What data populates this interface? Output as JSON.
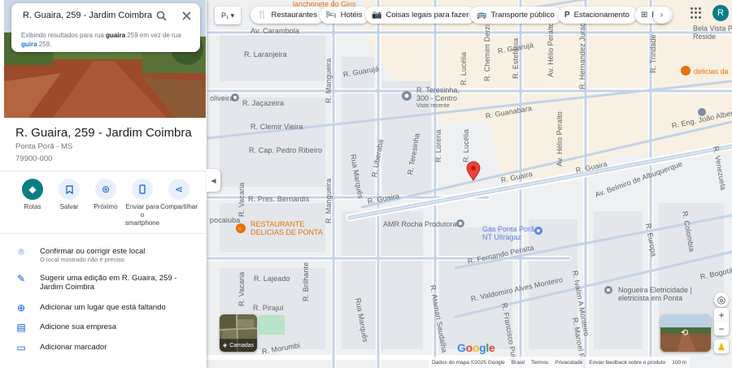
{
  "search": {
    "query": "R. Guaira, 259 - Jardim Coimbra",
    "hint_prefix": "Exibindo resultados para rua ",
    "hint_bold": "guaira",
    "hint_mid": " 259 em vez de rua ",
    "hint_link": "guira",
    "hint_suffix": " 259."
  },
  "place": {
    "title": "R. Guaira, 259 - Jardim Coimbra",
    "city": "Ponta Porã - MS",
    "postal": "79900-000"
  },
  "actions": [
    {
      "label": "Rotas",
      "icon": "directions-icon"
    },
    {
      "label": "Salvar",
      "icon": "bookmark-icon"
    },
    {
      "label": "Próximo",
      "icon": "nearby-icon"
    },
    {
      "label": "Enviar para o smartphone",
      "icon": "phone-icon"
    },
    {
      "label": "Compartilhar",
      "icon": "share-icon"
    }
  ],
  "rows": [
    {
      "label": "Confirmar ou corrigir este local",
      "sub": "O local mostrado não é preciso",
      "icon": "pin-outline-icon"
    },
    {
      "label": "Sugerir uma edição em R. Guaira, 259 - Jardim Coimbra",
      "icon": "pencil-icon"
    },
    {
      "label": "Adicionar um lugar que está faltando",
      "icon": "add-place-icon"
    },
    {
      "label": "Adicione sua empresa",
      "icon": "store-icon"
    },
    {
      "label": "Adicionar marcador",
      "icon": "label-icon"
    }
  ],
  "chips": [
    {
      "label": "Restaurantes",
      "icon": "restaurant-icon"
    },
    {
      "label": "Hotéis",
      "icon": "hotel-icon"
    },
    {
      "label": "Coisas legais para fazer",
      "icon": "camera-icon"
    },
    {
      "label": "Transporte público",
      "icon": "bus-icon"
    },
    {
      "label": "Estacionamento",
      "icon": "parking-icon"
    },
    {
      "label": "F",
      "icon": "pharmacy-icon"
    }
  ],
  "avatar_letter": "R",
  "layers_label": "Camadas",
  "map_labels": {
    "streets": {
      "carambola": "Av. Carambola",
      "laranjeira": "R. Laranjeira",
      "jacazeira": "R. Jaçazeira",
      "clemir": "R. Clemir Vieira",
      "cap": "R. Cap. Pedro Ribeiro",
      "pres": "R. Pres. Bernardis",
      "mangueira_top": "R. Mangueira",
      "mangueira_mid": "R. Mangueira",
      "guaruja": "R. Guarujá",
      "guaruja2": "R. Guarujá",
      "guanabara": "R. Guanabara",
      "guanabara2": "R. Guanabara",
      "guaira1": "R. Guaira",
      "guaira2": "R. Guaira",
      "guaira3": "R. Guaira",
      "belmiro": "Av. Belmiro de Albuquerque",
      "lorena": "R. Lorena",
      "lucelia": "R. Lucélia",
      "lucelia2": "R. Lucélia",
      "uberaba": "R. Uberaba",
      "teresinha": "R. Teresinha",
      "marques": "Rua Marquês",
      "marques2": "Rua Marquês",
      "vacaria": "R. Vacaria",
      "vacaria2": "R. Vacaria",
      "lajeado": "R. Lajeado",
      "pirajui": "R. Pirajuí",
      "brilhante": "R. Brilhante",
      "morumbi": "R. Morumbi",
      "peralta": "R. Fernando Peralta",
      "valdomiro": "R. Valdomiro Alves Monteiro",
      "chemim": "R. Chemim Derzi",
      "chemim2": "R. Chemim Derzi",
      "estefania": "R. Estefânia",
      "helio": "Av. Hélio Peralto",
      "helio2": "Av. Hélio Peralto",
      "hernandez": "R. Hernandez Jurado",
      "trindade": "R. Trindade",
      "ivalim": "R. Ivalim A Monteiro",
      "europa": "R. Europa",
      "colombia": "R. Colombia",
      "atamari": "R. Atamari Saudalha",
      "francisco": "R. Francisco Puig",
      "manoel": "R. Manoel Ramos",
      "venezuela": "R. Venezuela",
      "bogota": "R. Bogotá",
      "eng": "R. Eng. João Alberto Ca",
      "oliveira": "oliveira",
      "pocaiuba": "pocaiuba"
    },
    "pois": {
      "lanchonete": "lanchonete do Gins",
      "teresinha_name": "R. Teresinha,",
      "teresinha_addr": "300 - Centro",
      "teresinha_sub": "Visto recente",
      "restaurante1": "RESTAURANTE",
      "restaurante2": "DELICIAS DE PONTA",
      "amr": "AMR Rocha Produtora",
      "gas1": "Gás Ponta Porã",
      "gas2": "NT Ultragaz",
      "nogueira1": "Nogueira Eletricidade |",
      "nogueira2": "eletricista em Ponta",
      "bela1": "Bela Vista P",
      "bela2": "Reside",
      "delicias": "delicias da"
    }
  },
  "footer": {
    "data": "Dados do mapa ©2025 Google",
    "country": "Brasil",
    "terms": "Termos",
    "privacy": "Privacidade",
    "feedback": "Enviar feedback sobre o produto",
    "scale": "100 m"
  },
  "google_logo": "Google",
  "colors": {
    "accent": "#0b7e84",
    "blue": "#0b57d0",
    "pin": "#ea4335",
    "poi_orange": "#e8710a"
  }
}
